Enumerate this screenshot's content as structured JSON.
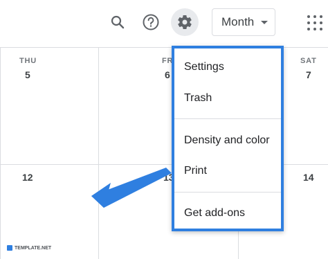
{
  "toolbar": {
    "view_selected": "Month"
  },
  "calendar": {
    "day_names": [
      "THU",
      "FR",
      "SAT"
    ],
    "week1": [
      "5",
      "6",
      "7"
    ],
    "week2": [
      "12",
      "13",
      "14"
    ]
  },
  "settings_menu": {
    "items": [
      "Settings",
      "Trash",
      "Density and color",
      "Print",
      "Get add-ons"
    ]
  },
  "watermark": "TEMPLATE.NET",
  "colors": {
    "highlight": "#2f7fe0",
    "gear_active_bg": "#e8eaed"
  },
  "icons": [
    "search-icon",
    "help-icon",
    "gear-icon",
    "apps-grid-icon",
    "arrow-pointer"
  ]
}
